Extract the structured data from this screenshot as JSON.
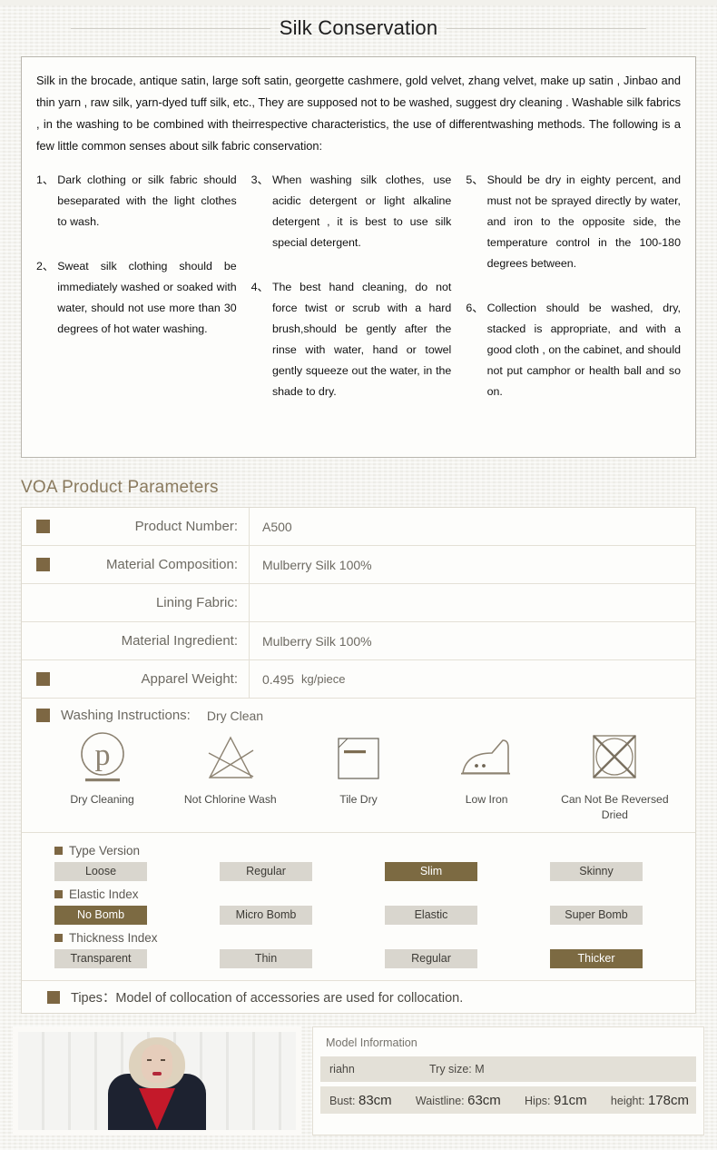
{
  "header": {
    "title": "Silk Conservation"
  },
  "conservation": {
    "intro": "Silk in the brocade, antique satin, large soft satin, georgette cashmere, gold velvet, zhang velvet, make up satin , Jinbao and thin yarn , raw silk, yarn-dyed tuff silk, etc., They are supposed not to be washed, suggest dry cleaning . Washable silk fabrics , in the washing to be combined with theirrespective characteristics, the use of differentwashing methods. The following is a few little common senses about silk fabric conservation:",
    "items": [
      {
        "num": "1、",
        "text": "Dark clothing or silk fabric should beseparated with the light clothes to wash."
      },
      {
        "num": "2、",
        "text": "Sweat silk clothing should be immediately washed or soaked with water, should not use more than 30 degrees of hot water washing."
      },
      {
        "num": "3、",
        "text": "When washing silk clothes, use acidic detergent or light alkaline detergent , it is best to use silk special detergent."
      },
      {
        "num": "4、",
        "text": "The best hand cleaning, do not force twist or scrub with a hard brush,should be gently after the rinse with water, hand or towel gently squeeze out the water, in the shade to dry."
      },
      {
        "num": "5、",
        "text": "Should be dry in eighty percent, and must not be sprayed directly by water, and iron to the opposite side, the temperature control in the 100-180 degrees between."
      },
      {
        "num": "6、",
        "text": "Collection should be washed, dry, stacked is appropriate, and with a good cloth , on the cabinet, and should not put camphor or health ball and so on."
      }
    ]
  },
  "params": {
    "heading": "VOA Product Parameters",
    "rows": [
      {
        "label": "Product Number:",
        "value": "A500",
        "marker": true
      },
      {
        "label": "Material Composition:",
        "value": "Mulberry Silk 100%",
        "marker": true
      },
      {
        "label": "Lining Fabric:",
        "value": "",
        "marker": false
      },
      {
        "label": "Material Ingredient:",
        "value": "Mulberry Silk 100%",
        "marker": false
      },
      {
        "label": "Apparel Weight:",
        "value": "0.495",
        "unit": "kg/piece",
        "marker": true
      }
    ]
  },
  "washing": {
    "label": "Washing Instructions:",
    "value": "Dry Clean",
    "icons": [
      {
        "icon": "dry-cleaning-icon",
        "caption": "Dry Cleaning"
      },
      {
        "icon": "no-chlorine-icon",
        "caption": "Not Chlorine Wash"
      },
      {
        "icon": "tile-dry-icon",
        "caption": "Tile Dry"
      },
      {
        "icon": "low-iron-icon",
        "caption": "Low Iron"
      },
      {
        "icon": "no-tumble-dry-icon",
        "caption": "Can Not Be Reversed Dried"
      }
    ]
  },
  "indexes": [
    {
      "label": "Type Version",
      "chips": [
        {
          "label": "Loose",
          "active": false
        },
        {
          "label": "Regular",
          "active": false
        },
        {
          "label": "Slim",
          "active": true
        },
        {
          "label": "Skinny",
          "active": false
        }
      ]
    },
    {
      "label": "Elastic Index",
      "chips": [
        {
          "label": "No  Bomb",
          "active": true
        },
        {
          "label": "Micro  Bomb",
          "active": false
        },
        {
          "label": "Elastic",
          "active": false
        },
        {
          "label": "Super  Bomb",
          "active": false
        }
      ]
    },
    {
      "label": "Thickness Index",
      "chips": [
        {
          "label": "Transparent",
          "active": false
        },
        {
          "label": "Thin",
          "active": false
        },
        {
          "label": "Regular",
          "active": false
        },
        {
          "label": "Thicker",
          "active": true
        }
      ]
    }
  ],
  "tipes": {
    "text": "Tipes：Model of collocation of accessories are used for collocation."
  },
  "model": {
    "title": "Model Information",
    "name": "riahn",
    "try_size": "Try size: M",
    "measurements": [
      {
        "label": "Bust:",
        "value": "83cm"
      },
      {
        "label": "Waistline:",
        "value": "63cm"
      },
      {
        "label": "Hips:",
        "value": "91cm"
      },
      {
        "label": "height:",
        "value": "178cm"
      }
    ]
  },
  "colors": {
    "accent_brown": "#7d6743",
    "chip_active": "#7c6a42",
    "chip_inactive": "#d9d6ce",
    "heading": "#8a7a5e",
    "background": "#f2f1ec"
  }
}
